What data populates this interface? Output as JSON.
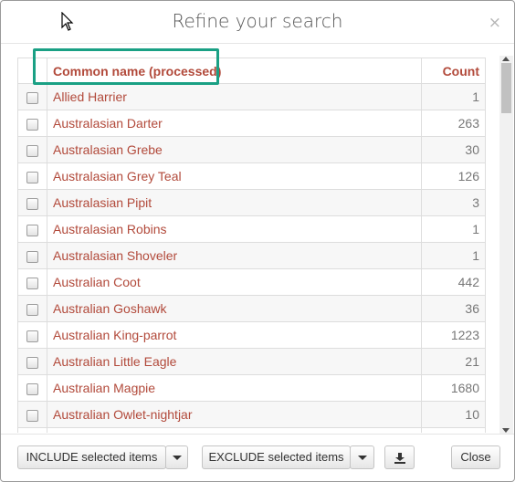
{
  "dialog": {
    "title": "Refine your search",
    "close_symbol": "×"
  },
  "table": {
    "headers": {
      "name": "Common name (processed)",
      "count": "Count"
    },
    "rows": [
      {
        "name": "Allied Harrier",
        "count": "1"
      },
      {
        "name": "Australasian Darter",
        "count": "263"
      },
      {
        "name": "Australasian Grebe",
        "count": "30"
      },
      {
        "name": "Australasian Grey Teal",
        "count": "126"
      },
      {
        "name": "Australasian Pipit",
        "count": "3"
      },
      {
        "name": "Australasian Robins",
        "count": "1"
      },
      {
        "name": "Australasian Shoveler",
        "count": "1"
      },
      {
        "name": "Australian Coot",
        "count": "442"
      },
      {
        "name": "Australian Goshawk",
        "count": "36"
      },
      {
        "name": "Australian King-parrot",
        "count": "1223"
      },
      {
        "name": "Australian Little Eagle",
        "count": "21"
      },
      {
        "name": "Australian Magpie",
        "count": "1680"
      },
      {
        "name": "Australian Owlet-nightjar",
        "count": "10"
      },
      {
        "name": "",
        "count": ""
      }
    ]
  },
  "footer": {
    "include_label": "INCLUDE selected items",
    "exclude_label": "EXCLUDE selected items",
    "close_label": "Close"
  },
  "colors": {
    "link": "#b24a3b",
    "highlight": "#1aa084"
  }
}
